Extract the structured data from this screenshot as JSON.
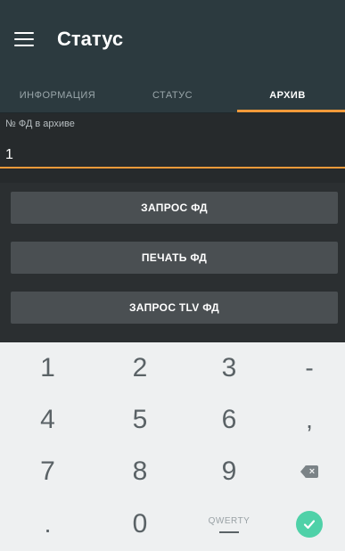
{
  "appbar": {
    "title": "Статус"
  },
  "tabs": [
    {
      "label": "ИНФОРМАЦИЯ"
    },
    {
      "label": "СТАТУС"
    },
    {
      "label": "АРХИВ"
    }
  ],
  "form": {
    "label": "№ ФД в архиве",
    "value": "1"
  },
  "buttons": {
    "request_fd": "ЗАПРОС ФД",
    "print_fd": "ПЕЧАТЬ ФД",
    "request_tlv_fd": "ЗАПРОС TLV ФД"
  },
  "keyboard": {
    "row1": [
      "1",
      "2",
      "3",
      "-"
    ],
    "row2": [
      "4",
      "5",
      "6",
      ","
    ],
    "row3": [
      "7",
      "8",
      "9"
    ],
    "row4": [
      ".",
      "0"
    ],
    "mode_label": "QWERTY"
  }
}
